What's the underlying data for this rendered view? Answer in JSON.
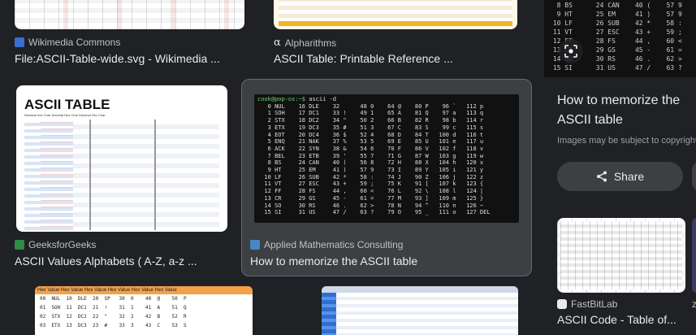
{
  "results": [
    {
      "source": "Wikimedia Commons",
      "title": "File:ASCII-Table-wide.svg - Wikimedia ...",
      "fav_color": "#3b6ed3"
    },
    {
      "source": "Alpharithms",
      "title": "ASCII Table: Printable Reference ...",
      "fav_glyph": "α"
    },
    {
      "source": "GeeksforGeeks",
      "title": "ASCII Values Alphabets ( A-Z, a-z ...",
      "fav_color": "#2f8d46"
    },
    {
      "source": "Applied Mathematics Consulting",
      "title": "How to memorize the ASCII table",
      "fav_color": "#4a86c7"
    }
  ],
  "thumb_text": {
    "ascii_table_heading": "ASCII TABLE",
    "gfg_header": "Decimal Hex Char  Decimal Hex Char  Decimal Hex Char",
    "bottom_left_header": "Hex Value Hex Value Hex Value Hex Value Hex Value Hex Value",
    "bottom_left_rows": [
      "00  NUL  10  DLE  20  SP   30  0    40  @    50  P",
      "01  SOH  11  DC1  21  !    31  1    41  A    51  Q",
      "02  STX  12  DC2  22  \"    32  2    42  B    52  R",
      "03  ETX  13  DC3  23  #    33  3    43  C    53  S"
    ]
  },
  "terminal": {
    "prompt": "cook@pop-os:~$",
    "command": " ascii -d",
    "lines": [
      "   0 NUL    16 DLE    32      48 0    64 @    80 P    96 `   112 p",
      "   1 SOH    17 DC1    33 !    49 1    65 A    81 Q    97 a   113 q",
      "   2 STX    18 DC2    34 \"    50 2    66 B    82 R    98 b   114 r",
      "   3 ETX    19 DC3    35 #    51 3    67 C    83 S    99 c   115 s",
      "   4 EOT    20 DC4    36 $    52 4    68 D    84 T   100 d   116 t",
      "   5 ENQ    21 NAK    37 %    53 5    69 E    85 U   101 e   117 u",
      "   6 ACK    22 SYN    38 &    54 6    70 F    86 V   102 f   118 v",
      "   7 BEL    23 ETB    39 '    55 7    71 G    87 W   103 g   119 w",
      "   8 BS     24 CAN    40 (    56 8    72 H    88 X   104 h   120 x",
      "   9 HT     25 EM     41 )    57 9    73 I    89 Y   105 i   121 y",
      "  10 LF     26 SUB    42 *    58 :    74 J    90 Z   106 j   122 z",
      "  11 VT     27 ESC    43 +    59 ;    75 K    91 [   107 k   123 {",
      "  12 FF     28 FS     44 ,    60 <    76 L    92 \\   108 l   124 |",
      "  13 CR     29 GS     45 -    61 =    77 M    93 ]   109 m   125 }",
      "  14 SO     30 RS     46 .    62 >    78 N    94 ^   110 n   126 ~",
      "  15 SI     31 US     47 /    63 ?    79 O    95 _   111 o   127 DEL"
    ]
  },
  "right_panel": {
    "preview_lines": [
      "  8 BS      24 CAN    40 (    57 9",
      "  9 HT      25 EM     41 )    57 9",
      " 10 LF      26 SUB    42 *    58 :",
      " 11 VT      27 ESC    43 +    59 ;",
      " 12 FF      28 FS     44 ,    60 <",
      " 13 CR      29 GS     45 -    61 =",
      " 14 SO      30 RS     46 .    62 >",
      " 15 SI      31 US     47 /    63 ?"
    ],
    "title": "How to memorize the ASCII table",
    "note": "Images may be subject to copyright.",
    "share_label": "Share",
    "related_source": "FastBitLab",
    "related_title": "ASCII Code - Table of...",
    "related_source2": "z"
  }
}
